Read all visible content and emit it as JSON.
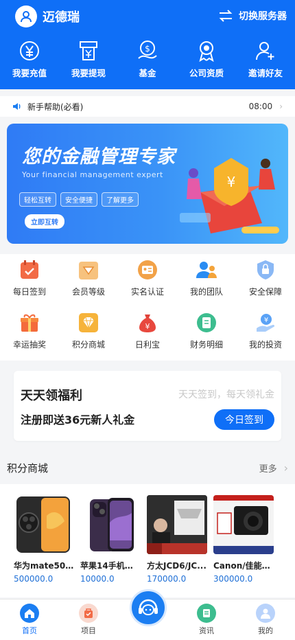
{
  "header": {
    "username": "迈德瑞",
    "switch_label": "切换服务器",
    "nav": [
      {
        "label": "我要充值",
        "icon": "recharge-icon"
      },
      {
        "label": "我要提现",
        "icon": "withdraw-icon"
      },
      {
        "label": "基金",
        "icon": "fund-icon"
      },
      {
        "label": "公司资质",
        "icon": "qualification-icon"
      },
      {
        "label": "邀请好友",
        "icon": "invite-icon"
      }
    ]
  },
  "notice": {
    "text": "新手帮助(必看)",
    "time": "08:00"
  },
  "banner": {
    "title": "您的金融管理专家",
    "subtitle": "Your financial management expert",
    "chips": [
      "轻松互转",
      "安全便捷",
      "了解更多"
    ],
    "button": "立即互转"
  },
  "grid": {
    "row1": [
      {
        "label": "每日签到",
        "icon": "calendar-icon"
      },
      {
        "label": "会员等级",
        "icon": "diamond-box-icon"
      },
      {
        "label": "实名认证",
        "icon": "id-card-icon"
      },
      {
        "label": "我的团队",
        "icon": "team-icon"
      },
      {
        "label": "安全保障",
        "icon": "shield-icon"
      }
    ],
    "row2": [
      {
        "label": "幸运抽奖",
        "icon": "gift-icon"
      },
      {
        "label": "积分商城",
        "icon": "diamond-icon"
      },
      {
        "label": "日利宝",
        "icon": "money-bag-icon"
      },
      {
        "label": "财务明细",
        "icon": "ledger-icon"
      },
      {
        "label": "我的投资",
        "icon": "investment-icon"
      }
    ]
  },
  "welfare": {
    "title": "天天领福利",
    "slogan": "天天签到，每天领礼金",
    "desc": "注册即送36元新人礼金",
    "button": "今日签到"
  },
  "shop": {
    "title": "积分商城",
    "more": "更多",
    "products": [
      {
        "name": "华为mate50p...",
        "price": "500000.0"
      },
      {
        "name": "苹果14手机官...",
        "price": "10000.0"
      },
      {
        "name": "方太JCD6/JC...",
        "price": "170000.0"
      },
      {
        "name": "Canon/佳能g...",
        "price": "300000.0"
      }
    ]
  },
  "bottomnav": [
    {
      "label": "首页",
      "icon": "home-icon"
    },
    {
      "label": "项目",
      "icon": "project-icon"
    },
    {
      "label": "资讯",
      "icon": "news-icon"
    },
    {
      "label": "我的",
      "icon": "profile-icon"
    }
  ],
  "colors": {
    "primary": "#0f6ff7",
    "price": "#1e6fd6"
  }
}
